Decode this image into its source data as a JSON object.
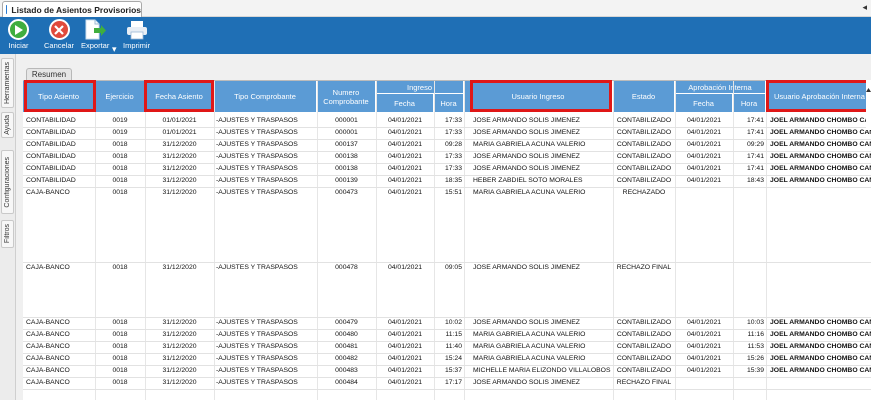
{
  "window": {
    "tab_title": "Listado de Asientos Provisorios"
  },
  "toolbar": {
    "buttons": [
      {
        "label": "Iniciar"
      },
      {
        "label": "Cancelar"
      },
      {
        "label": "Exportar"
      },
      {
        "label": "Imprimir"
      }
    ]
  },
  "sidebar": {
    "tabs": [
      "Herramientas",
      "Ayuda",
      "Configuraciones",
      "Filtros"
    ]
  },
  "summary_tab": "Resumen",
  "grid": {
    "group_headers": {
      "ingreso": "Ingreso",
      "aprobacion": "Aprobación Interna"
    },
    "headers": {
      "tipo_asiento": "Tipo Asiento",
      "ejercicio": "Ejercicio",
      "fecha_asiento": "Fecha Asiento",
      "tipo_comprobante": "Tipo Comprobante",
      "numero_comprobante": "Numero Comprobante",
      "ing_fecha": "Fecha",
      "ing_hora": "Hora",
      "usuario_ingreso": "Usuario Ingreso",
      "estado": "Estado",
      "apr_fecha": "Fecha",
      "apr_hora": "Hora",
      "usuario_aprobacion": "Usuario Aprobación Interna"
    },
    "rows": [
      {
        "tipo": "CONTABILIDAD",
        "ej": "0019",
        "fecha": "01/01/2021",
        "comp": "-AJUSTES Y TRASPASOS",
        "num": "000001",
        "ifecha": "04/01/2021",
        "ihora": "17:33",
        "usuario": "JOSE ARMANDO SOLIS JIMENEZ",
        "estado": "CONTABILIZADO",
        "afecha": "04/01/2021",
        "ahora": "17:41",
        "aprob": "JOEL ARMANDO CHOMBO CAN"
      },
      {
        "tipo": "CONTABILIDAD",
        "ej": "0019",
        "fecha": "01/01/2021",
        "comp": "-AJUSTES Y TRASPASOS",
        "num": "000001",
        "ifecha": "04/01/2021",
        "ihora": "17:33",
        "usuario": "JOSE ARMANDO SOLIS JIMENEZ",
        "estado": "CONTABILIZADO",
        "afecha": "04/01/2021",
        "ahora": "17:41",
        "aprob": "JOEL ARMANDO CHOMBO CAN"
      },
      {
        "tipo": "CONTABILIDAD",
        "ej": "0018",
        "fecha": "31/12/2020",
        "comp": "-AJUSTES Y TRASPASOS",
        "num": "000137",
        "ifecha": "04/01/2021",
        "ihora": "09:28",
        "usuario": "MARIA GABRIELA ACUNA VALERIO",
        "estado": "CONTABILIZADO",
        "afecha": "04/01/2021",
        "ahora": "09:29",
        "aprob": "JOEL ARMANDO CHOMBO CAN"
      },
      {
        "tipo": "CONTABILIDAD",
        "ej": "0018",
        "fecha": "31/12/2020",
        "comp": "-AJUSTES Y TRASPASOS",
        "num": "000138",
        "ifecha": "04/01/2021",
        "ihora": "17:33",
        "usuario": "JOSE ARMANDO SOLIS JIMENEZ",
        "estado": "CONTABILIZADO",
        "afecha": "04/01/2021",
        "ahora": "17:41",
        "aprob": "JOEL ARMANDO CHOMBO CAN"
      },
      {
        "tipo": "CONTABILIDAD",
        "ej": "0018",
        "fecha": "31/12/2020",
        "comp": "-AJUSTES Y TRASPASOS",
        "num": "000138",
        "ifecha": "04/01/2021",
        "ihora": "17:33",
        "usuario": "JOSE ARMANDO SOLIS JIMENEZ",
        "estado": "CONTABILIZADO",
        "afecha": "04/01/2021",
        "ahora": "17:41",
        "aprob": "JOEL ARMANDO CHOMBO CAN"
      },
      {
        "tipo": "CONTABILIDAD",
        "ej": "0018",
        "fecha": "31/12/2020",
        "comp": "-AJUSTES Y TRASPASOS",
        "num": "000139",
        "ifecha": "04/01/2021",
        "ihora": "18:35",
        "usuario": "HEBER ZABDIEL SOTO MORALES",
        "estado": "CONTABILIZADO",
        "afecha": "04/01/2021",
        "ahora": "18:43",
        "aprob": "JOEL ARMANDO CHOMBO CAN"
      },
      {
        "tipo": "CAJA-BANCO",
        "ej": "0018",
        "fecha": "31/12/2020",
        "comp": "-AJUSTES Y TRASPASOS",
        "num": "000473",
        "ifecha": "04/01/2021",
        "ihora": "15:51",
        "usuario": "MARIA GABRIELA ACUNA VALERIO",
        "estado": "RECHAZADO",
        "afecha": "",
        "ahora": "",
        "aprob": ""
      },
      {
        "tipo": "CAJA-BANCO",
        "ej": "0018",
        "fecha": "31/12/2020",
        "comp": "-AJUSTES Y TRASPASOS",
        "num": "000478",
        "ifecha": "04/01/2021",
        "ihora": "09:05",
        "usuario": "JOSE ARMANDO SOLIS JIMENEZ",
        "estado": "RECHAZO FINAL",
        "afecha": "",
        "ahora": "",
        "aprob": ""
      },
      {
        "tipo": "CAJA-BANCO",
        "ej": "0018",
        "fecha": "31/12/2020",
        "comp": "-AJUSTES Y TRASPASOS",
        "num": "000479",
        "ifecha": "04/01/2021",
        "ihora": "10:02",
        "usuario": "JOSE ARMANDO SOLIS JIMENEZ",
        "estado": "CONTABILIZADO",
        "afecha": "04/01/2021",
        "ahora": "10:03",
        "aprob": "JOEL ARMANDO CHOMBO CAN"
      },
      {
        "tipo": "CAJA-BANCO",
        "ej": "0018",
        "fecha": "31/12/2020",
        "comp": "-AJUSTES Y TRASPASOS",
        "num": "000480",
        "ifecha": "04/01/2021",
        "ihora": "11:15",
        "usuario": "MARIA GABRIELA ACUNA VALERIO",
        "estado": "CONTABILIZADO",
        "afecha": "04/01/2021",
        "ahora": "11:16",
        "aprob": "JOEL ARMANDO CHOMBO CAN"
      },
      {
        "tipo": "CAJA-BANCO",
        "ej": "0018",
        "fecha": "31/12/2020",
        "comp": "-AJUSTES Y TRASPASOS",
        "num": "000481",
        "ifecha": "04/01/2021",
        "ihora": "11:40",
        "usuario": "MARIA GABRIELA ACUNA VALERIO",
        "estado": "CONTABILIZADO",
        "afecha": "04/01/2021",
        "ahora": "11:53",
        "aprob": "JOEL ARMANDO CHOMBO CAN"
      },
      {
        "tipo": "CAJA-BANCO",
        "ej": "0018",
        "fecha": "31/12/2020",
        "comp": "-AJUSTES Y TRASPASOS",
        "num": "000482",
        "ifecha": "04/01/2021",
        "ihora": "15:24",
        "usuario": "MARIA GABRIELA ACUNA VALERIO",
        "estado": "CONTABILIZADO",
        "afecha": "04/01/2021",
        "ahora": "15:26",
        "aprob": "JOEL ARMANDO CHOMBO CAN"
      },
      {
        "tipo": "CAJA-BANCO",
        "ej": "0018",
        "fecha": "31/12/2020",
        "comp": "-AJUSTES Y TRASPASOS",
        "num": "000483",
        "ifecha": "04/01/2021",
        "ihora": "15:37",
        "usuario": "MICHELLE MARIA ELIZONDO VILLALOBOS",
        "estado": "CONTABILIZADO",
        "afecha": "04/01/2021",
        "ahora": "15:39",
        "aprob": "JOEL ARMANDO CHOMBO CAN"
      },
      {
        "tipo": "CAJA-BANCO",
        "ej": "0018",
        "fecha": "31/12/2020",
        "comp": "-AJUSTES Y TRASPASOS",
        "num": "000484",
        "ifecha": "04/01/2021",
        "ihora": "17:17",
        "usuario": "JOSE ARMANDO SOLIS JIMENEZ",
        "estado": "RECHAZO FINAL",
        "afecha": "",
        "ahora": "",
        "aprob": ""
      }
    ]
  },
  "colors": {
    "toolbar": "#1f6fb5",
    "header": "#5b9bd5",
    "highlight": "#e01717"
  }
}
